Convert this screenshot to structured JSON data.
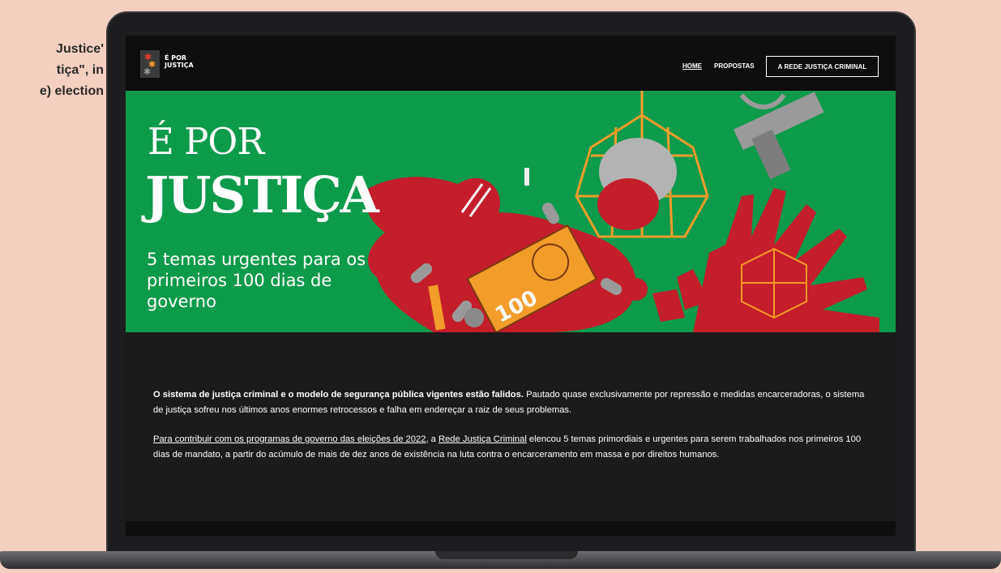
{
  "side_caption": {
    "line1": "Justice'",
    "line2": "tiça\", in",
    "line3": "e)  election"
  },
  "logo": {
    "line1": "É POR",
    "line2": "JUSTIÇA",
    "mark_colors": [
      "#e63b2e",
      "#f39c2a",
      "#9b9b9b"
    ]
  },
  "nav": {
    "home": "HOME",
    "proposals": "PROPOSTAS",
    "network": "A REDE JUSTIÇA CRIMINAL"
  },
  "hero": {
    "title_line1": "É POR",
    "title_line2": "JUSTIÇA",
    "subtitle": "5 temas urgentes para os primeiros 100 dias de governo",
    "banknote_value": "100",
    "background": "#0c9a4b"
  },
  "body": {
    "p1_bold": "O sistema de justiça criminal e o modelo de segurança pública vigentes estão falidos.",
    "p1_rest": " Pautado quase exclusivamente por repressão e medidas encarceradoras, o sistema de justiça sofreu nos últimos anos enormes retrocessos e falha em endereçar a raiz de seus problemas.",
    "p2_link1": "Para contribuir com os programas de governo das eleições de 2022",
    "p2_mid": ", a ",
    "p2_link2": "Rede Justiça Criminal",
    "p2_rest": " elencou 5 temas primordiais e urgentes para serem trabalhados nos primeiros 100 dias de mandato, a partir do acúmulo de mais de dez anos de existência na luta contra o encarceramento em massa e por direitos humanos."
  }
}
